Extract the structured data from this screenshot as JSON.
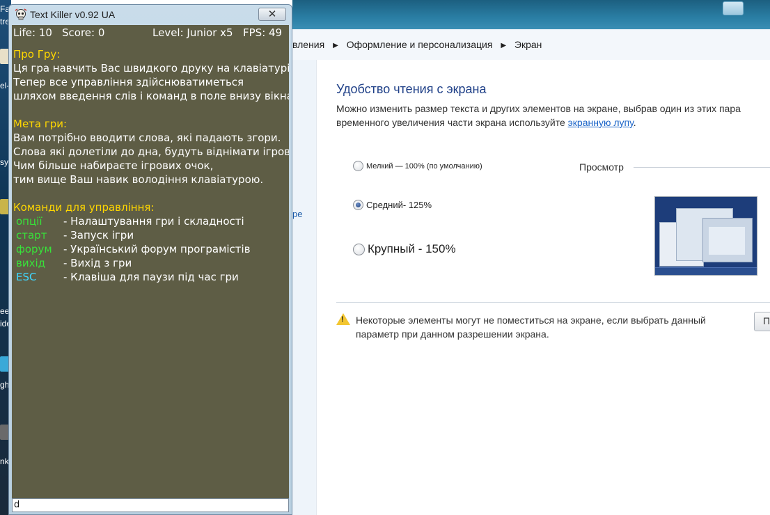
{
  "desktop": {
    "fragments": [
      "Fa",
      "tre",
      "el-",
      "sy",
      "ee",
      "ide",
      "gh",
      "nkl"
    ]
  },
  "control_panel": {
    "top_fragment": "...",
    "breadcrumb": {
      "items": [
        "вления",
        "Оформление и персонализация",
        "Экран"
      ]
    },
    "left_fragment": "ре",
    "title": "Удобство чтения с экрана",
    "description_line1": "Можно изменить размер текста и других элементов на экране, выбрав один из этих пара",
    "description_line2_prefix": "временного увеличения части экрана используйте ",
    "description_link": "экранную лупу",
    "description_line2_suffix": ".",
    "options": [
      {
        "label": "Мелкий — 100% (по умолчанию)",
        "checked": false
      },
      {
        "label": "Средний- 125%",
        "checked": true
      },
      {
        "label": "Крупный - 150%",
        "checked": false
      }
    ],
    "preview_label": "Просмотр",
    "warning_text": "Некоторые элементы могут не поместиться на экране, если выбрать данный параметр при данном разрешении экрана.",
    "button_fragment": "П"
  },
  "text_killer": {
    "window_title": "Text Killer v0.92 UA",
    "close_symbol": "✕",
    "status": {
      "life": "Life: 10",
      "score": "Score: 0",
      "level": "Level: Junior x5",
      "fps": "FPS: 49"
    },
    "about_heading": "Про Гру:",
    "about_lines": [
      "Ця гра навчить Вас швидкого друку на клавіатурі.",
      "Тепер все управління здійснюватиметься",
      "шляхом введення слів і команд в поле внизу вікна."
    ],
    "goal_heading": "Мета гри:",
    "goal_lines": [
      "Вам потрібно вводити слова, які падають згори.",
      "Слова які долетіли до дна, будуть віднімати ігрові життя.",
      "Чим більше набираєте ігрових очок,",
      "тим вище Ваш навик володіння клавіатурою."
    ],
    "commands_heading": "Команди для управління:",
    "commands": [
      {
        "name": "опції",
        "desc": "- Налаштування гри і складності",
        "color": "#38e23a"
      },
      {
        "name": "старт",
        "desc": "- Запуск ігри",
        "color": "#38e23a"
      },
      {
        "name": "форум",
        "desc": "- Український форум програмістів",
        "color": "#38e23a"
      },
      {
        "name": "вихід",
        "desc": "- Вихід з гри",
        "color": "#38e23a"
      },
      {
        "name": "ESC",
        "desc": "- Клавіша для паузи під час гри",
        "color": "#3fd8ff"
      }
    ],
    "input_value": "d"
  }
}
